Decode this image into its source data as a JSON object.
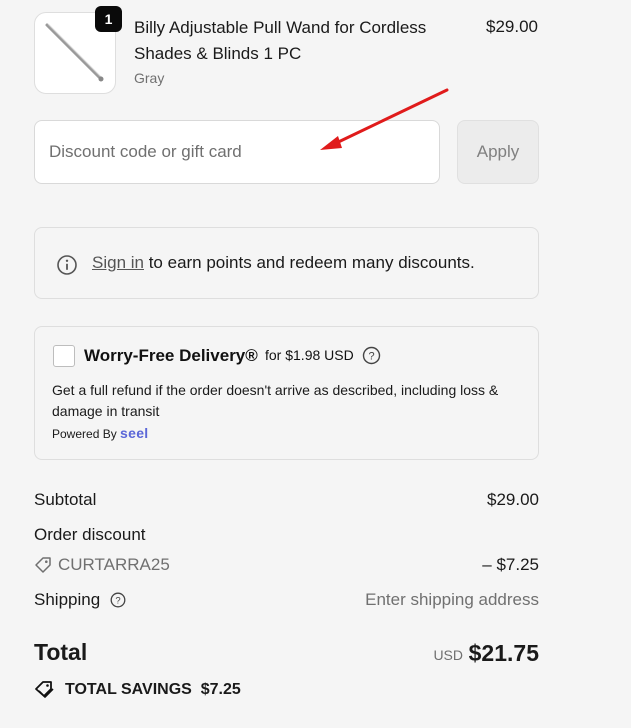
{
  "product": {
    "quantity": "1",
    "name": "Billy Adjustable Pull Wand for Cordless Shades & Blinds 1 PC",
    "variant": "Gray",
    "price": "$29.00",
    "image_icon": "pull-wand-image"
  },
  "discount": {
    "placeholder": "Discount code or gift card",
    "apply_label": "Apply"
  },
  "signin": {
    "link_text": "Sign in",
    "rest_text": " to earn points and redeem many discounts."
  },
  "worry_free": {
    "title": "Worry-Free Delivery®",
    "price_text": "for $1.98 USD",
    "description": "Get a full refund if the order doesn't arrive as described, including loss & damage in transit",
    "powered_by": "Powered By",
    "brand": "seel",
    "checked": false
  },
  "summary": {
    "subtotal_label": "Subtotal",
    "subtotal_value": "$29.00",
    "order_discount_label": "Order discount",
    "discount_code": "CURTARRA25",
    "discount_value": "– $7.25",
    "shipping_label": "Shipping",
    "shipping_value": "Enter shipping address",
    "total_label": "Total",
    "currency": "USD",
    "total_value": "$21.75",
    "savings_label": "TOTAL SAVINGS",
    "savings_value": "$7.25"
  },
  "colors": {
    "annotation_arrow": "#e01b1b",
    "seel_brand": "#5b67d8",
    "badge_bg": "#0a0a0a"
  }
}
